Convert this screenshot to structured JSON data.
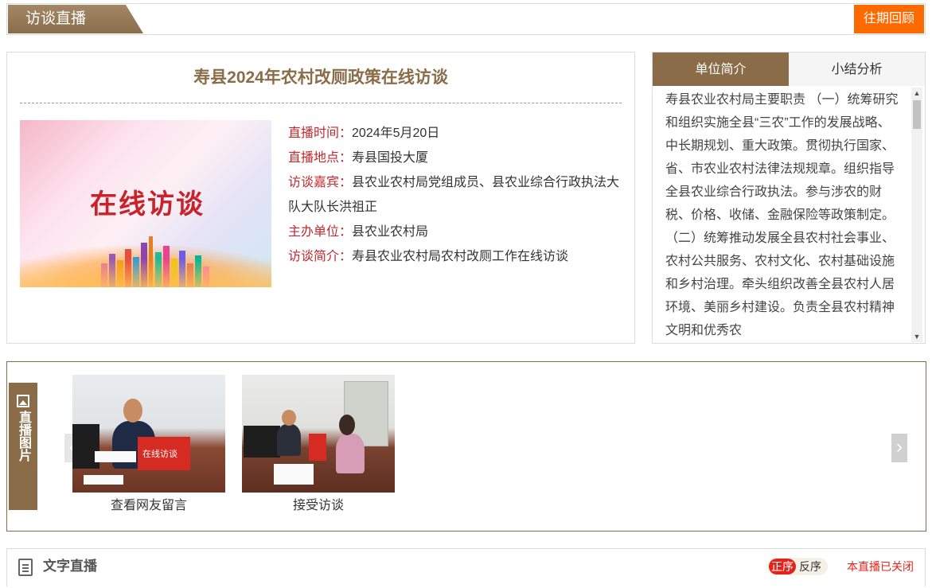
{
  "header": {
    "section_title": "访谈直播",
    "review_button": "往期回顾"
  },
  "interview": {
    "title": "寿县2024年农村改厕政策在线访谈",
    "cover_text": "在线访谈",
    "details": [
      {
        "label": "直播时间：",
        "value": "2024年5月20日"
      },
      {
        "label": "直播地点：",
        "value": "寿县国投大厦"
      },
      {
        "label": "访谈嘉宾：",
        "value": "县农业农村局党组成员、县农业综合行政执法大队大队长洪祖正"
      },
      {
        "label": "主办单位：",
        "value": "县农业农村局"
      },
      {
        "label": "访谈简介：",
        "value": "寿县农业农村局农村改厕工作在线访谈"
      }
    ]
  },
  "side_panel": {
    "tabs": [
      {
        "label": "单位简介",
        "active": true
      },
      {
        "label": "小结分析",
        "active": false
      }
    ],
    "content": "寿县农业农村局主要职责 （一）统筹研究和组织实施全县“三农”工作的发展战略、中长期规划、重大政策。贯彻执行国家、省、市农业农村法律法规规章。组织指导全县农业综合行政执法。参与涉农的财税、价格、收储、金融保险等政策制定。 （二）统筹推动发展全县农村社会事业、农村公共服务、农村文化、农村基础设施和乡村治理。牵头组织改善全县农村人居环境、美丽乡村建设。负责全县农村精神文明和优秀农"
  },
  "photos": {
    "tab_label": "直播图片",
    "items": [
      {
        "caption": "查看网友留言",
        "laptop_text": "在线访谈"
      },
      {
        "caption": "接受访谈"
      }
    ]
  },
  "live_text": {
    "label": "文字直播",
    "sort_asc": "正序",
    "sort_desc": "反序",
    "status": "本直播已关闭"
  },
  "colors": {
    "brand_brown": "#8b6c48",
    "accent_orange": "#ff6a00",
    "label_red": "#c0282d",
    "status_red": "#e0251e"
  }
}
